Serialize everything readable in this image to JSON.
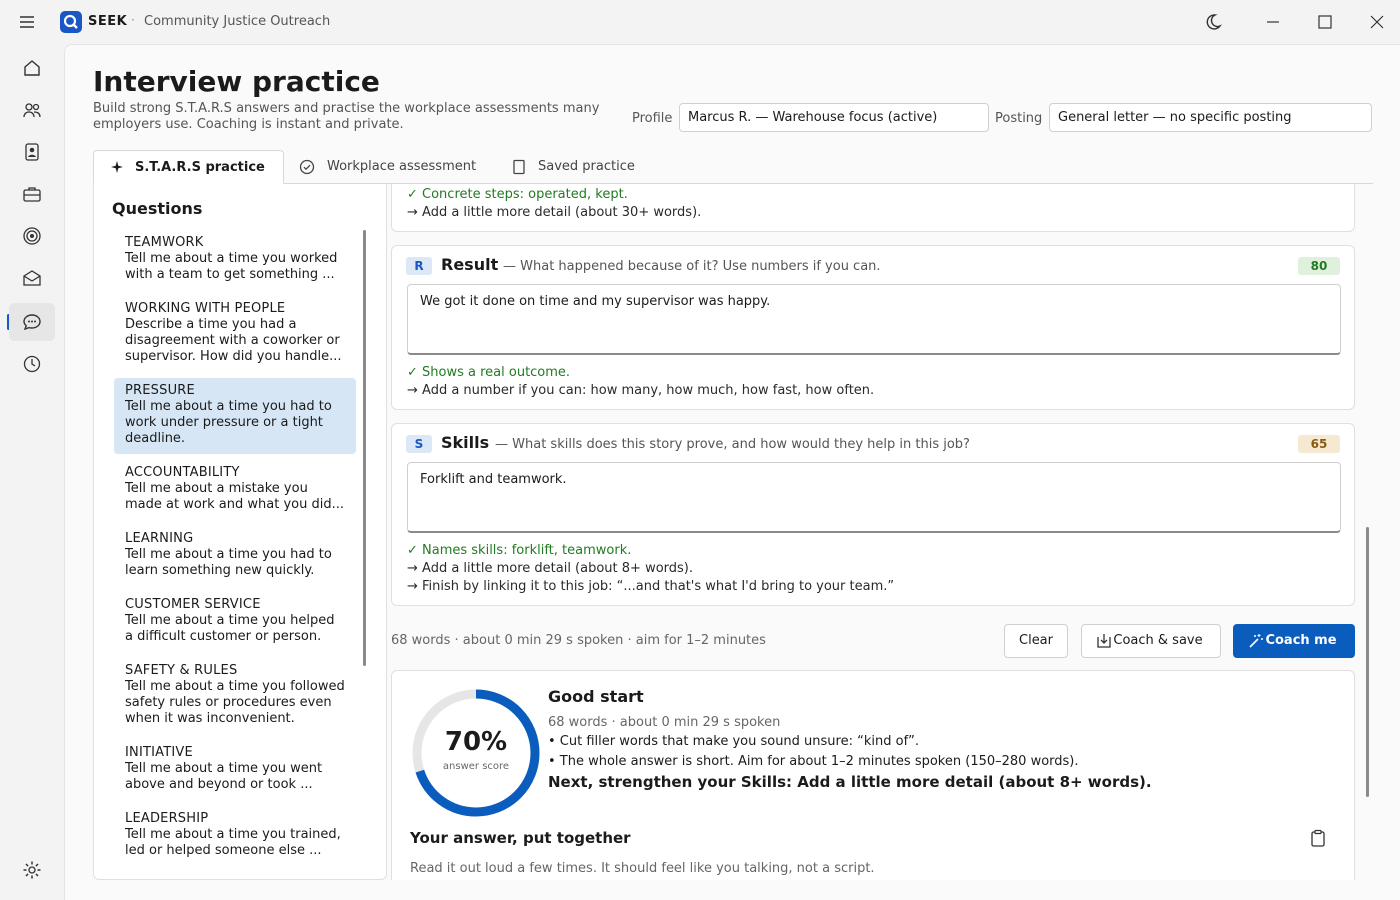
{
  "app": {
    "brand": "SEEK",
    "separator": "·",
    "org": "Community Justice Outreach"
  },
  "sidebar": {
    "items": [
      {
        "name": "home-icon"
      },
      {
        "name": "people-icon"
      },
      {
        "name": "id-card-icon"
      },
      {
        "name": "briefcase-icon"
      },
      {
        "name": "target-icon"
      },
      {
        "name": "inbox-icon"
      },
      {
        "name": "chat-icon",
        "active": true
      },
      {
        "name": "history-icon"
      }
    ],
    "settings": "gear-icon"
  },
  "page": {
    "title": "Interview practice",
    "subtitle": "Build strong S.T.A.R.S answers and practise the workplace assessments many employers use. Coaching is instant and private.",
    "profile_label": "Profile",
    "profile_value": "Marcus R. — Warehouse focus  (active)",
    "posting_label": "Posting",
    "posting_value": "General letter — no specific posting"
  },
  "tabs": [
    {
      "label": "S.T.A.R.S practice",
      "active": true
    },
    {
      "label": "Workplace assessment"
    },
    {
      "label": "Saved practice"
    }
  ],
  "questions": {
    "heading": "Questions",
    "items": [
      {
        "category": "TEAMWORK",
        "text": "Tell me about a time you worked with a team to get something ..."
      },
      {
        "category": "WORKING WITH PEOPLE",
        "text": "Describe a time you had a disagreement with a coworker or supervisor. How did you handle..."
      },
      {
        "category": "PRESSURE",
        "text": "Tell me about a time you had to work under pressure or a tight deadline.",
        "selected": true
      },
      {
        "category": "ACCOUNTABILITY",
        "text": "Tell me about a mistake you made at work and what you did..."
      },
      {
        "category": "LEARNING",
        "text": "Tell me about a time you had to learn something new quickly."
      },
      {
        "category": "CUSTOMER SERVICE",
        "text": "Tell me about a time you helped a difficult customer or person."
      },
      {
        "category": "SAFETY & RULES",
        "text": "Tell me about a time you followed safety rules or procedures even when it was inconvenient."
      },
      {
        "category": "INITIATIVE",
        "text": "Tell me about a time you went above and beyond or took ..."
      },
      {
        "category": "LEADERSHIP",
        "text": "Tell me about a time you trained, led or helped someone else ..."
      }
    ]
  },
  "prev_feedback": {
    "good": "✓ Concrete steps: operated, kept.",
    "tip": "→ Add a little more detail (about 30+ words)."
  },
  "result": {
    "badge": "R",
    "title": "Result",
    "prompt": "— What happened because of it? Use numbers if you can.",
    "score": "80",
    "answer": "We got it done on time and my supervisor was happy.",
    "good": "✓ Shows a real outcome.",
    "tip": "→ Add a number if you can: how many, how much, how fast, how often."
  },
  "skills": {
    "badge": "S",
    "title": "Skills",
    "prompt": "— What skills does this story prove, and how would they help in this job?",
    "score": "65",
    "answer": "Forklift and teamwork.",
    "good": "✓ Names skills: forklift, teamwork.",
    "tip1": "→ Add a little more detail (about 8+ words).",
    "tip2": "→ Finish by linking it to this job: “...and that's what I'd bring to your team.”"
  },
  "actions": {
    "meta": "68 words · about 0 min 29 s spoken · aim for 1–2 minutes",
    "clear": "Clear",
    "coach_save": "Coach & save",
    "coach_me": "Coach me"
  },
  "coaching": {
    "score_pct": "70%",
    "score_value": 0.7,
    "score_label": "answer score",
    "headline": "Good start",
    "meta": "68 words · about 0 min 29 s spoken",
    "bullet1": "• Cut filler words that make you sound unsure: “kind of”.",
    "bullet2": "• The whole answer is short. Aim for about 1–2 minutes spoken (150–280 words).",
    "next": "Next, strengthen your Skills: Add a little more detail (about 8+ words).",
    "together_title": "Your answer, put together",
    "together_sub": "Read it out loud a few times. It should feel like you talking, not a script."
  },
  "colors": {
    "accent": "#0a5cbd",
    "good": "#237a23",
    "selected": "#d6e6f5"
  }
}
